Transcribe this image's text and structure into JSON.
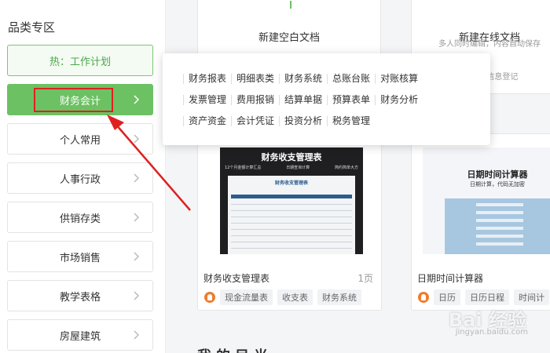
{
  "sidebar": {
    "title": "品类专区",
    "hot": "热：工作计划",
    "items": [
      {
        "label": "财务会计",
        "active": true
      },
      {
        "label": "个人常用"
      },
      {
        "label": "人事行政"
      },
      {
        "label": "供销存类"
      },
      {
        "label": "市场销售"
      },
      {
        "label": "教学表格"
      },
      {
        "label": "房屋建筑"
      }
    ]
  },
  "dropdown": {
    "rows": [
      [
        "财务报表",
        "明细表类",
        "财务系统",
        "总账台账",
        "对账核算"
      ],
      [
        "发票管理",
        "费用报销",
        "结算单据",
        "预算表单",
        "财务分析"
      ],
      [
        "资产资金",
        "会计凭证",
        "投资分析",
        "税务管理"
      ]
    ]
  },
  "new_cards": {
    "blank": {
      "title": "新建空白文档"
    },
    "online": {
      "title": "新建在线文档",
      "sub": "多人同时编辑，内容自动保存",
      "sub2": "/多人信息登记"
    }
  },
  "templates": [
    {
      "name": "财务收支管理表",
      "pages": "1页",
      "tags": [
        "现金流量表",
        "收支表",
        "财务系统"
      ],
      "thumb_title": "财务收支管理表",
      "thumb_tags": [
        "12个月金额计算汇总",
        "日期查询计算",
        "简约简单大方"
      ],
      "sheet_title": "财务收支管理表"
    },
    {
      "name": "日期时间计算器",
      "tags": [
        "日历",
        "日历日程",
        "时间计"
      ],
      "thumb_title": "日期时间计算器",
      "thumb_sub": "日期计算，代码无加密"
    }
  ],
  "bottom_heading": "我的目光",
  "watermark": {
    "brand": "Bai 经验",
    "url": "jingyan.baidu.com"
  },
  "colors": {
    "accent": "#6cc163",
    "highlight": "#e02020"
  }
}
